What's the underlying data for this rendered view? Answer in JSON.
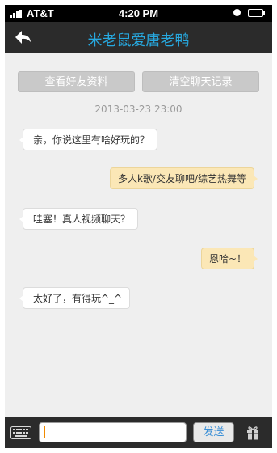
{
  "status_bar": {
    "carrier": "AT&T",
    "time": "4:20 PM",
    "icons": [
      "signal-bars-icon",
      "alarm-icon",
      "battery-icon"
    ]
  },
  "nav": {
    "back_icon": "back-arrow-icon",
    "title": "米老鼠爱唐老鸭",
    "title_color": "#27a9e0"
  },
  "actions": {
    "view_profile": "查看好友资料",
    "clear_history": "清空聊天记录"
  },
  "timestamp": "2013-03-23   23:00",
  "messages": [
    {
      "side": "left",
      "text": "亲，你说这里有啥好玩的？"
    },
    {
      "side": "right",
      "text": "多人k歌/交友聊吧/综艺热舞等"
    },
    {
      "side": "left",
      "text": "哇塞！真人视频聊天？"
    },
    {
      "side": "right",
      "text": "恩哈~！"
    },
    {
      "side": "left",
      "text": "太好了，有得玩^_^"
    }
  ],
  "input_bar": {
    "keyboard_icon": "keyboard-icon",
    "message_value": "",
    "send_label": "发送",
    "gift_icon": "gift-icon"
  },
  "colors": {
    "incoming_bubble": "#ffffff",
    "outgoing_bubble": "#fbe7b6",
    "bar_background": "#2b2b2b",
    "screen_background": "#efefef"
  }
}
